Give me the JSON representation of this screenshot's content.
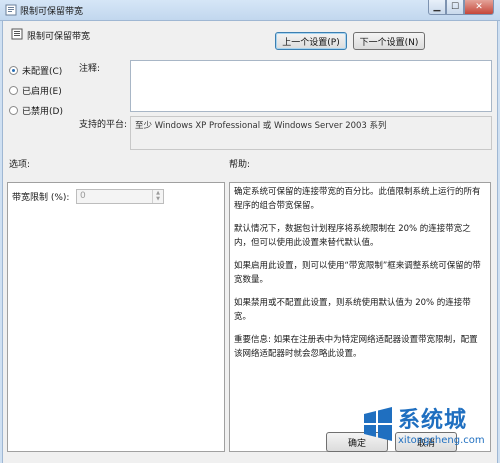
{
  "window": {
    "title": "限制可保留带宽"
  },
  "header": {
    "setting_name": "限制可保留带宽",
    "prev_button": "上一个设置(P)",
    "next_button": "下一个设置(N)"
  },
  "state_options": [
    {
      "label": "未配置(C)",
      "selected": true
    },
    {
      "label": "已启用(E)",
      "selected": false
    },
    {
      "label": "已禁用(D)",
      "selected": false
    }
  ],
  "comment": {
    "label": "注释:",
    "value": ""
  },
  "platform": {
    "label": "支持的平台:",
    "value": "至少 Windows XP Professional 或 Windows Server 2003 系列"
  },
  "options": {
    "label": "选项:",
    "bandwidth_label": "带宽限制 (%):",
    "bandwidth_value": "0"
  },
  "help": {
    "label": "帮助:",
    "paragraphs": [
      "确定系统可保留的连接带宽的百分比。此值限制系统上运行的所有程序的组合带宽保留。",
      "默认情况下，数据包计划程序将系统限制在 20% 的连接带宽之内，但可以使用此设置来替代默认值。",
      "如果启用此设置，则可以使用“带宽限制”框来调整系统可保留的带宽数量。",
      "如果禁用或不配置此设置，则系统使用默认值为 20% 的连接带宽。",
      "重要信息: 如果在注册表中为特定网络适配器设置带宽限制，配置该网络适配器时就会忽略此设置。"
    ]
  },
  "footer": {
    "ok_button": "确定",
    "cancel_button": "取消"
  },
  "watermark": {
    "brand": "系统城",
    "url": "xitongcheng.com"
  },
  "colors": {
    "accent": "#2a6fb5",
    "watermark": "#1f6fc0"
  }
}
